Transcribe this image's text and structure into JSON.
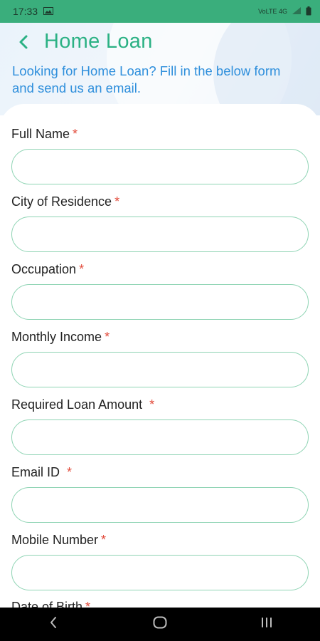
{
  "status_bar": {
    "time": "17:33",
    "signal_text": "VoLTE 4G"
  },
  "header": {
    "title": "Home Loan",
    "subtitle": "Looking for Home Loan? Fill in the below form and send us an email."
  },
  "form": {
    "fields": [
      {
        "label": "Full Name",
        "required_mark": "*",
        "value": ""
      },
      {
        "label": "City of Residence",
        "required_mark": "*",
        "value": ""
      },
      {
        "label": "Occupation",
        "required_mark": "*",
        "value": ""
      },
      {
        "label": "Monthly Income",
        "required_mark": "*",
        "value": ""
      },
      {
        "label": "Required Loan Amount",
        "required_mark": "*",
        "value": ""
      },
      {
        "label": "Email ID",
        "required_mark": "*",
        "value": ""
      },
      {
        "label": "Mobile Number",
        "required_mark": "*",
        "value": ""
      },
      {
        "label": "Date of Birth",
        "required_mark": "*",
        "value": ""
      }
    ]
  },
  "colors": {
    "status_bar": "#3aae7c",
    "title": "#2bb184",
    "subtitle": "#2f8fdc",
    "input_border": "#8fd4b4",
    "required": "#e24b3b"
  }
}
